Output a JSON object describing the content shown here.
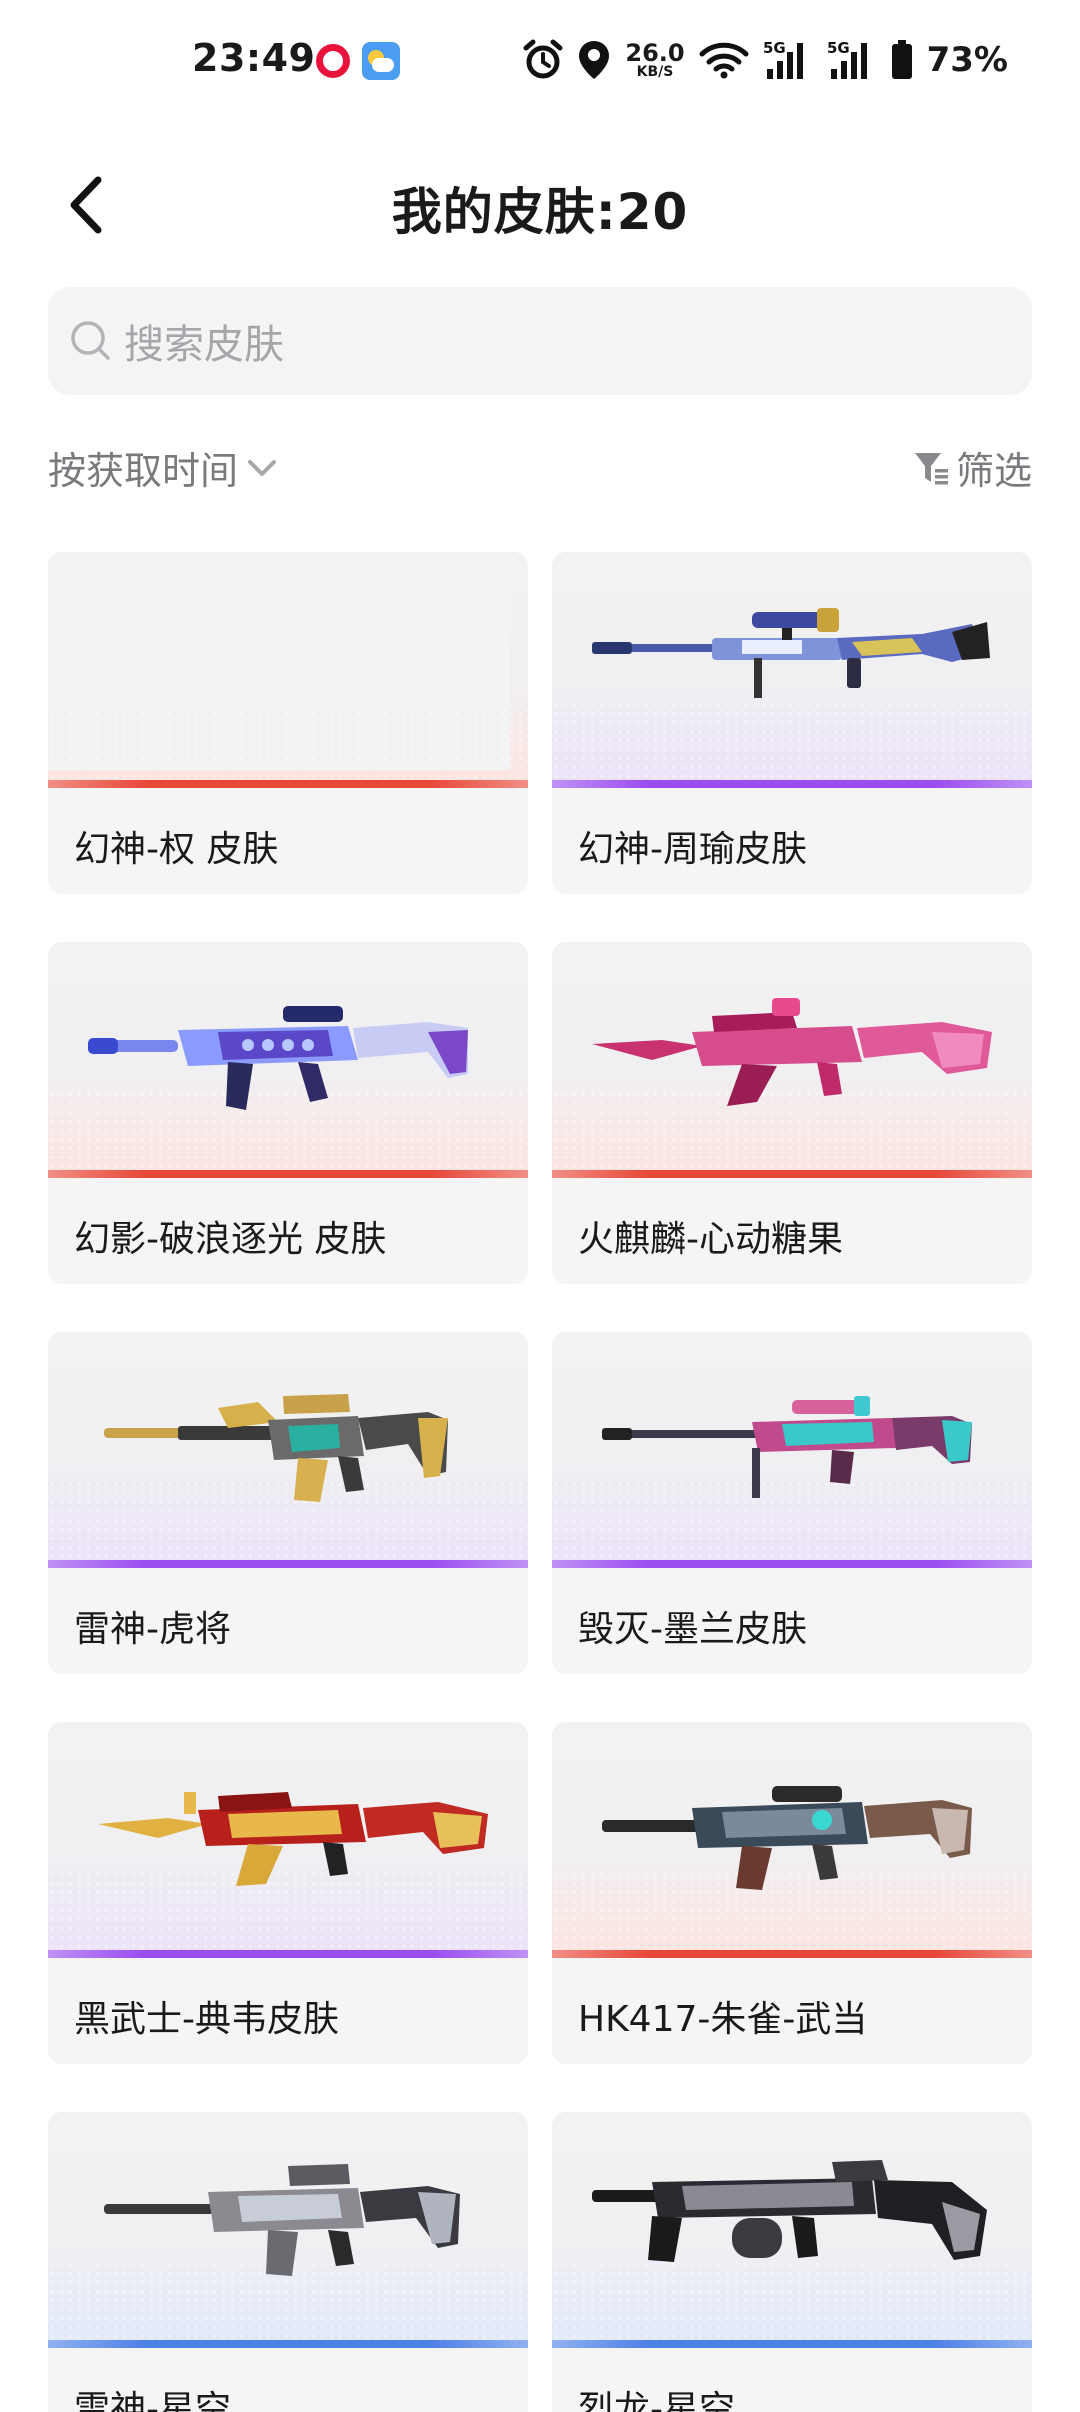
{
  "status_bar": {
    "time": "23:49",
    "net_speed": "26.0",
    "net_speed_unit": "KB/S",
    "signal1_label": "5G",
    "signal2_label": "5G",
    "battery": "73%"
  },
  "header": {
    "title": "我的皮肤:20"
  },
  "search": {
    "placeholder": "搜索皮肤"
  },
  "sort": {
    "label": "按获取时间"
  },
  "filter": {
    "label": "筛选"
  },
  "colors": {
    "red_rarity": "#e8483a",
    "purple_rarity": "#9a4ef0",
    "blue_rarity": "#4f82e8"
  },
  "skins": [
    {
      "name": "幻神-权 皮肤",
      "rarity": "red",
      "image": "none"
    },
    {
      "name": "幻神-周瑜皮肤",
      "rarity": "purple",
      "image": "sniper-rifle"
    },
    {
      "name": "幻影-破浪逐光 皮肤",
      "rarity": "red",
      "image": "assault-rifle"
    },
    {
      "name": "火麒麟-心动糖果",
      "rarity": "red",
      "image": "ak-rifle"
    },
    {
      "name": "雷神-虎将",
      "rarity": "purple",
      "image": "m4-rifle"
    },
    {
      "name": "毁灭-墨兰皮肤",
      "rarity": "purple",
      "image": "sniper-rifle"
    },
    {
      "name": "黑武士-典韦皮肤",
      "rarity": "purple",
      "image": "ak-rifle"
    },
    {
      "name": "HK417-朱雀-武当",
      "rarity": "red",
      "image": "battle-rifle"
    },
    {
      "name": "雷神-星空",
      "rarity": "blue",
      "image": "m4-rifle"
    },
    {
      "name": "烈龙-星空",
      "rarity": "blue",
      "image": "smg"
    }
  ]
}
